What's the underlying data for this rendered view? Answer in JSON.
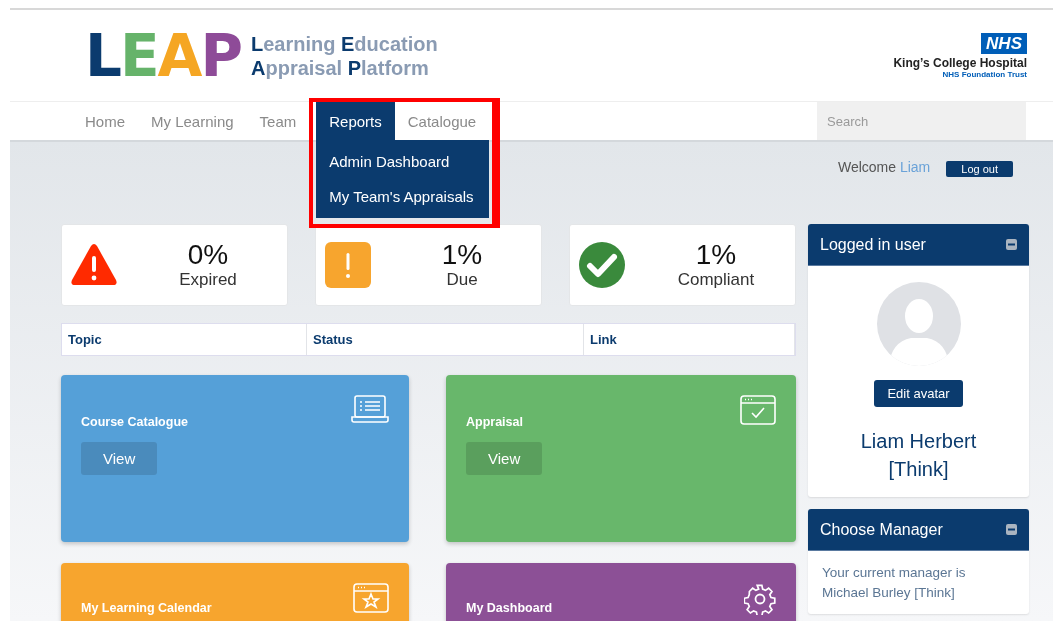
{
  "header": {
    "logo": {
      "letters": "LEAP",
      "line_1": "**L**earning **E**ducation",
      "line_2": "**A**ppraisal **P**latform"
    },
    "org": {
      "badge": "NHS",
      "name": "King’s College Hospital",
      "subtitle": "NHS Foundation Trust"
    }
  },
  "nav": {
    "items": [
      {
        "label": "Home",
        "selected": false
      },
      {
        "label": "My Learning",
        "selected": false
      },
      {
        "label": "Team",
        "selected": false
      },
      {
        "label": "Reports",
        "selected": true
      },
      {
        "label": "Catalogue",
        "selected": false
      }
    ],
    "menu": {
      "open": true,
      "highlighted": true,
      "items": [
        "Admin Dashboard",
        "My Team's Appraisals"
      ]
    },
    "search": {
      "placeholder": "Search"
    }
  },
  "welcome": {
    "greeting": "Welcome",
    "user": "Liam",
    "logout": "Log out"
  },
  "stats": [
    {
      "kind": "expired",
      "value": "0%",
      "label": "Expired"
    },
    {
      "kind": "due",
      "value": "1%",
      "label": "Due"
    },
    {
      "kind": "compliant",
      "value": "1%",
      "label": "Compliant"
    }
  ],
  "table": {
    "columns": [
      "Topic",
      "Status",
      "Link"
    ]
  },
  "tiles": [
    {
      "kind": "laptop",
      "title": "Course Catalogue",
      "button": "View",
      "color": "#55a0d8"
    },
    {
      "kind": "browser-check",
      "title": "Appraisal",
      "button": "View",
      "color": "#68b76b"
    },
    {
      "kind": "browser-star",
      "title": "My Learning Calendar",
      "color": "#f7a52e"
    },
    {
      "kind": "gear",
      "title": "My Dashboard",
      "color": "#8c5096"
    }
  ],
  "panels": [
    {
      "kind": "user",
      "title": "Logged in user",
      "button": "Edit avatar",
      "name": "Liam Herbert [Think]"
    },
    {
      "kind": "manager",
      "title": "Choose Manager",
      "text": "Your current manager is Michael Burley [Think]"
    }
  ]
}
